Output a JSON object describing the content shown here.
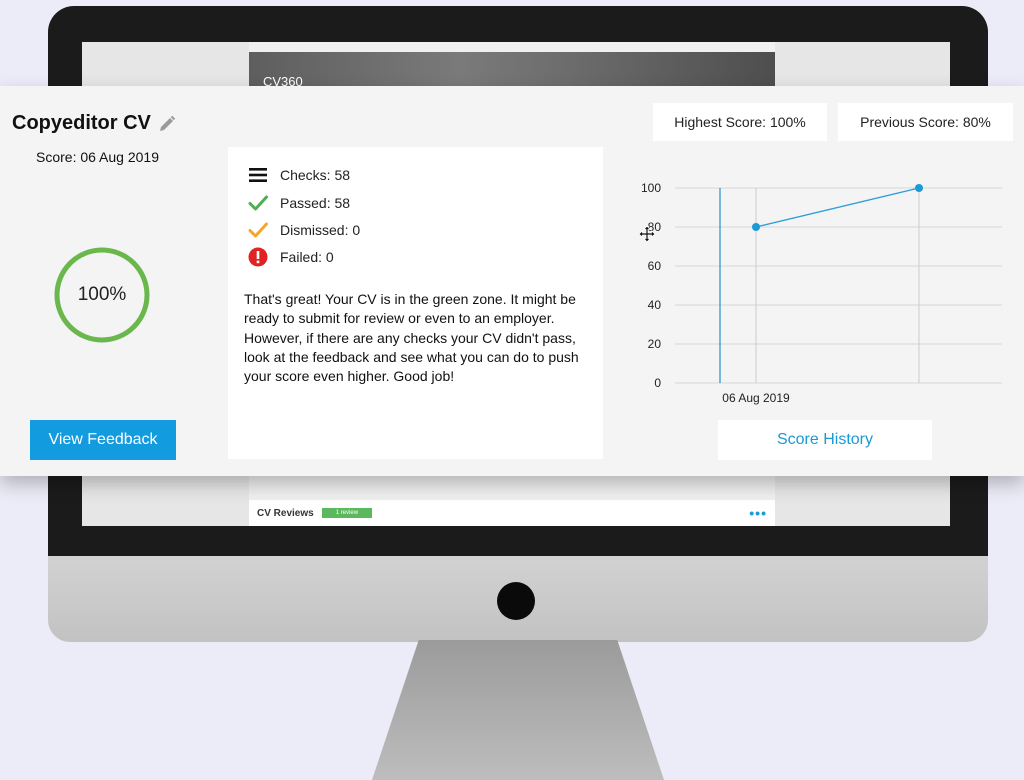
{
  "background_app": {
    "brand": "CV360",
    "reviews_label": "CV Reviews",
    "reviews_badge": "1 review",
    "more_icon": "ellipsis-icon"
  },
  "card": {
    "title": "Copyeditor CV",
    "edit_icon": "pencil-icon",
    "score_date": "Score: 06 Aug 2019",
    "score_percent": "100%",
    "score_fraction": 1.0,
    "view_feedback_label": "View Feedback",
    "highest_score": "Highest Score: 100%",
    "previous_score": "Previous Score: 80%",
    "score_history_label": "Score History"
  },
  "checks": {
    "items": [
      {
        "label": "Checks: 58",
        "icon": "list-icon"
      },
      {
        "label": "Passed: 58",
        "icon": "checkmark-green-icon"
      },
      {
        "label": "Dismissed: 0",
        "icon": "checkmark-orange-icon"
      },
      {
        "label": "Failed: 0",
        "icon": "alert-red-icon"
      }
    ],
    "summary": "That's great! Your CV is in the green zone. It might be ready to submit for review or even to an employer. However, if there are any checks your CV didn't pass, look at the feedback and see what you can do to push your score even higher. Good job!"
  },
  "colors": {
    "accent_blue": "#139be0",
    "ring_green": "#6ab84c",
    "passed_green": "#4caf50",
    "dismissed_orange": "#f4a62a",
    "failed_red": "#e02424"
  },
  "chart_data": {
    "type": "line",
    "x": [
      "06 Aug 2019"
    ],
    "yticks": [
      0,
      20,
      40,
      60,
      80,
      100
    ],
    "ylim": [
      0,
      100
    ],
    "grid": true,
    "series": [
      {
        "values": [
          80,
          100
        ]
      }
    ]
  }
}
